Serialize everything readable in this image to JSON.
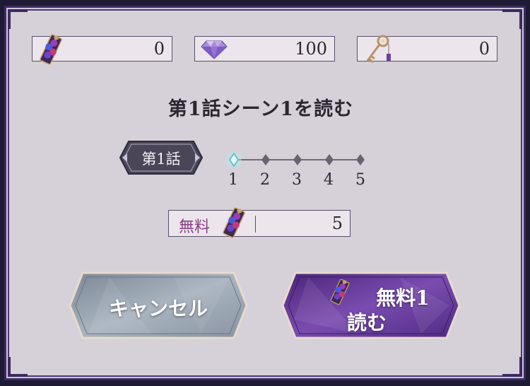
{
  "currencies": {
    "tickets": {
      "icon": "bouquet-ticket-icon",
      "value": "0"
    },
    "gems": {
      "icon": "purple-diamond-icon",
      "value": "100"
    },
    "keys": {
      "icon": "ornate-key-icon",
      "value": "0"
    }
  },
  "dialog": {
    "title": "第1話シーン1を読む",
    "episode_label": "第1話",
    "scenes": [
      "1",
      "2",
      "3",
      "4",
      "5"
    ],
    "selected_scene": "1"
  },
  "cost": {
    "free_label": "無料",
    "icon": "bouquet-ticket-icon",
    "value": "5"
  },
  "buttons": {
    "cancel_label": "キャンセル",
    "read_line1": "無料1",
    "read_line2": "読む"
  },
  "colors": {
    "accent_purple": "#5a2f8e",
    "frame": "#3b2a60",
    "free_text": "#8a3f86",
    "cancel_button": "#8e9aa8"
  }
}
